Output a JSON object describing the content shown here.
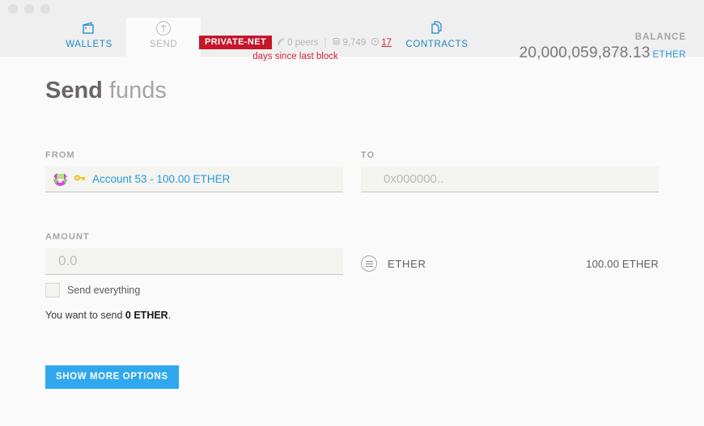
{
  "window": {
    "controls": [
      "close",
      "minimize",
      "maximize"
    ]
  },
  "nav": {
    "tabs": [
      {
        "id": "wallets",
        "label": "WALLETS",
        "icon": "wallet-icon",
        "state": "blue",
        "active": false
      },
      {
        "id": "send",
        "label": "SEND",
        "icon": "send-arrow-icon",
        "state": "gray",
        "active": true
      },
      {
        "id": "contracts",
        "label": "CONTRACTS",
        "icon": "documents-icon",
        "state": "blue",
        "active": false
      }
    ]
  },
  "status": {
    "network_badge": "PRIVATE-NET",
    "peers_icon": "signal-icon",
    "peers": "0 peers",
    "separator": "|",
    "blocks_icon": "blocks-icon",
    "blocks": "9,749",
    "time_icon": "clock-icon",
    "days": "17",
    "since_text": "days since last block"
  },
  "balance": {
    "label": "BALANCE",
    "value": "20,000,059,878.13",
    "unit": "ETHER"
  },
  "page": {
    "title_bold": "Send",
    "title_light": " funds"
  },
  "form": {
    "from": {
      "label": "FROM",
      "key_icon": "key-icon",
      "identicon": "account-identicon",
      "account_text": "Account 53 - 100.00 ETHER"
    },
    "to": {
      "label": "TO",
      "value": "",
      "placeholder": "0x000000.."
    },
    "amount": {
      "label": "AMOUNT",
      "value": "",
      "placeholder": "0.0"
    },
    "send_everything": {
      "label": "Send everything",
      "checked": false
    },
    "summary_prefix": "You want to send ",
    "summary_amount": "0 ETHER",
    "summary_suffix": ".",
    "unit_selector": {
      "icon": "circle-menu-icon",
      "name": "ETHER",
      "available": "100.00 ETHER"
    },
    "show_more_button": "SHOW MORE OPTIONS"
  },
  "colors": {
    "accent_blue": "#2b9bd8",
    "button_blue": "#2fa8ee",
    "badge_red": "#c5162a",
    "alert_red": "#d2243a",
    "chrome_bg": "#efefef",
    "page_bg": "#fafafa",
    "field_bg": "#f3f3f0"
  }
}
